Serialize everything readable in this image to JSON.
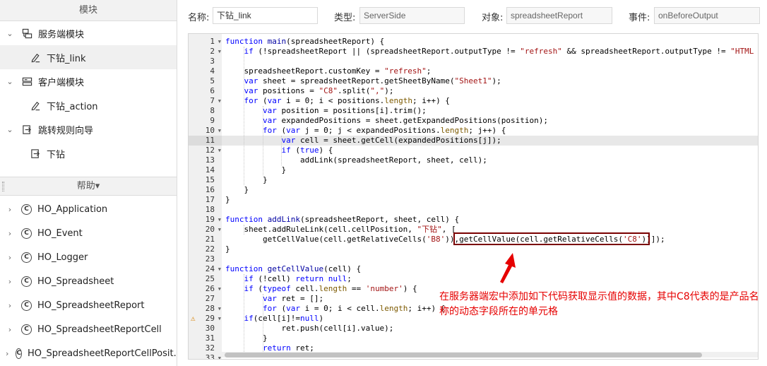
{
  "left_panel": {
    "modules_title": "模块",
    "modules": [
      {
        "label": "服务端模块",
        "icon": "server-module-icon",
        "expanded": true
      },
      {
        "label": "下钻_link",
        "icon": "pencil-script-icon",
        "selected": true
      },
      {
        "label": "客户端模块",
        "icon": "client-module-icon",
        "expanded": true
      },
      {
        "label": "下钻_action",
        "icon": "pencil-script-icon"
      },
      {
        "label": "跳转规则向导",
        "icon": "jump-rule-icon",
        "expanded": true
      },
      {
        "label": "下钻",
        "icon": "jump-item-icon"
      }
    ],
    "help_title": "帮助▾",
    "help_items": [
      {
        "label": "HO_Application"
      },
      {
        "label": "HO_Event"
      },
      {
        "label": "HO_Logger"
      },
      {
        "label": "HO_Spreadsheet"
      },
      {
        "label": "HO_SpreadsheetReport"
      },
      {
        "label": "HO_SpreadsheetReportCell"
      },
      {
        "label": "HO_SpreadsheetReportCellPosit..."
      }
    ]
  },
  "fields": {
    "name_label": "名称:",
    "name_value": "下钻_link",
    "type_label": "类型:",
    "type_value": "ServerSide",
    "object_label": "对象:",
    "object_value": "spreadsheetReport",
    "event_label": "事件:",
    "event_value": "onBeforeOutput"
  },
  "editor": {
    "active_line": 11,
    "warning_line": 29,
    "lines": [
      {
        "n": "1",
        "fold": true,
        "code": "function main(spreadsheetReport) {"
      },
      {
        "n": "2",
        "fold": true,
        "code": "    if (!spreadsheetReport || (spreadsheetReport.outputType != \"refresh\" && spreadsheetReport.outputType != \"HTML"
      },
      {
        "n": "3",
        "fold": false,
        "code": ""
      },
      {
        "n": "4",
        "fold": false,
        "code": "    spreadsheetReport.customKey = \"refresh\";"
      },
      {
        "n": "5",
        "fold": false,
        "code": "    var sheet = spreadsheetReport.getSheetByName(\"Sheet1\");"
      },
      {
        "n": "6",
        "fold": false,
        "code": "    var positions = \"C8\".split(\",\");"
      },
      {
        "n": "7",
        "fold": true,
        "code": "    for (var i = 0; i < positions.length; i++) {"
      },
      {
        "n": "8",
        "fold": false,
        "code": "        var position = positions[i].trim();"
      },
      {
        "n": "9",
        "fold": false,
        "code": "        var expandedPositions = sheet.getExpandedPositions(position);"
      },
      {
        "n": "10",
        "fold": true,
        "code": "        for (var j = 0; j < expandedPositions.length; j++) {"
      },
      {
        "n": "11",
        "fold": false,
        "code": "            var cell = sheet.getCell(expandedPositions[j]);"
      },
      {
        "n": "12",
        "fold": true,
        "code": "            if (true) {"
      },
      {
        "n": "13",
        "fold": false,
        "code": "                addLink(spreadsheetReport, sheet, cell);"
      },
      {
        "n": "14",
        "fold": false,
        "code": "            }"
      },
      {
        "n": "15",
        "fold": false,
        "code": "        }"
      },
      {
        "n": "16",
        "fold": false,
        "code": "    }"
      },
      {
        "n": "17",
        "fold": false,
        "code": "}"
      },
      {
        "n": "18",
        "fold": false,
        "code": ""
      },
      {
        "n": "19",
        "fold": true,
        "code": "function addLink(spreadsheetReport, sheet, cell) {"
      },
      {
        "n": "20",
        "fold": true,
        "code": "    sheet.addRuleLink(cell.cellPosition, \"下钻\", ["
      },
      {
        "n": "21",
        "fold": false,
        "code": "        getCellValue(cell.getRelativeCells('B8')),getCellValue(cell.getRelativeCells('C8'))]);"
      },
      {
        "n": "22",
        "fold": false,
        "code": "}"
      },
      {
        "n": "23",
        "fold": false,
        "code": ""
      },
      {
        "n": "24",
        "fold": true,
        "code": "function getCellValue(cell) {"
      },
      {
        "n": "25",
        "fold": false,
        "code": "    if (!cell) return null;"
      },
      {
        "n": "26",
        "fold": true,
        "code": "    if (typeof cell.length == 'number') {"
      },
      {
        "n": "27",
        "fold": false,
        "code": "        var ret = [];"
      },
      {
        "n": "28",
        "fold": true,
        "code": "        for (var i = 0; i < cell.length; i++) {"
      },
      {
        "n": "29",
        "fold": true,
        "code": "    if(cell[i]!=null)"
      },
      {
        "n": "30",
        "fold": false,
        "code": "            ret.push(cell[i].value);"
      },
      {
        "n": "31",
        "fold": false,
        "code": "        }"
      },
      {
        "n": "32",
        "fold": false,
        "code": "        return ret;"
      },
      {
        "n": "33",
        "fold": true,
        "code": ""
      }
    ]
  },
  "annotation": {
    "text": "在服务器端宏中添加如下代码获取显示值的数据，其中C8代表的是产品名称的动态字段所在的单元格",
    "color": "#e60000",
    "box_color": "#7a0000"
  }
}
